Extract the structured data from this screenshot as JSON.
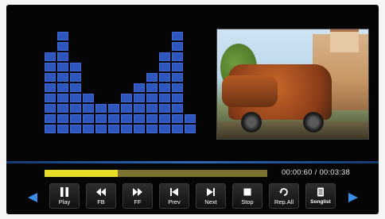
{
  "player": {
    "progress_fraction": 0.33,
    "elapsed": "00:00:60",
    "separator": "/",
    "total": "00:03:38",
    "accent_color": "#e8db2a",
    "equalizer_color": "#2f56bd",
    "equalizer_levels": [
      8,
      10,
      7,
      4,
      3,
      3,
      4,
      5,
      6,
      8,
      10,
      2
    ]
  },
  "controls": [
    {
      "label": "Play",
      "icon": "pause-icon"
    },
    {
      "label": "FB",
      "icon": "fast-backward-icon"
    },
    {
      "label": "FF",
      "icon": "fast-forward-icon"
    },
    {
      "label": "Prev",
      "icon": "previous-icon"
    },
    {
      "label": "Next",
      "icon": "next-icon"
    },
    {
      "label": "Stop",
      "icon": "stop-icon"
    },
    {
      "label": "Rep.All",
      "icon": "repeat-icon"
    },
    {
      "label": "Songlist",
      "icon": "songlist-icon"
    }
  ],
  "nav": {
    "left_icon": "arrow-left-icon",
    "right_icon": "arrow-right-icon"
  }
}
